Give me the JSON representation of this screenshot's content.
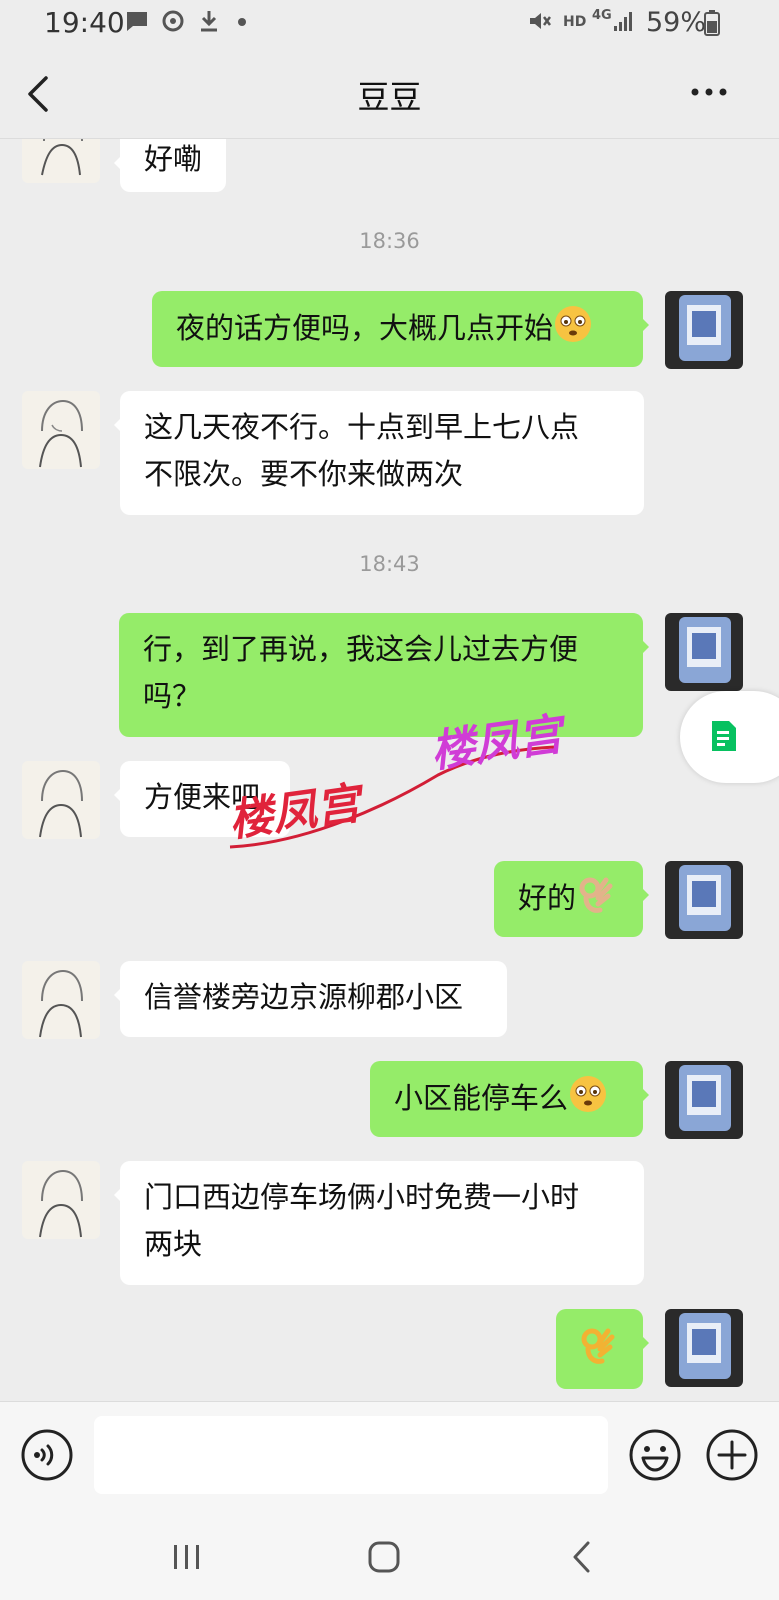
{
  "status_bar": {
    "time": "19:40",
    "network": "4G",
    "hd": "HD",
    "battery": "59%"
  },
  "header": {
    "title": "豆豆"
  },
  "messages": [
    {
      "dir": "in",
      "text": "好嘞"
    },
    {
      "timestamp": "18:36"
    },
    {
      "dir": "out",
      "text": "夜的话方便吗，大概几点开始",
      "emoji": "flushed-face"
    },
    {
      "dir": "in",
      "lines": [
        "这几天夜不行。十点到早上七八点",
        "不限次。要不你来做两次"
      ]
    },
    {
      "timestamp": "18:43"
    },
    {
      "dir": "out",
      "lines": [
        "行，到了再说，我这会儿过去方便",
        "吗？"
      ]
    },
    {
      "dir": "in",
      "text": "方便来吧"
    },
    {
      "dir": "out",
      "text": "好的",
      "emoji": "ok-hand"
    },
    {
      "dir": "in",
      "text": "信誉楼旁边京源柳郡小区"
    },
    {
      "dir": "out",
      "text": "小区能停车么",
      "emoji": "flushed-face"
    },
    {
      "dir": "in",
      "lines": [
        "门口西边停车场俩小时免费一小时",
        "两块"
      ]
    },
    {
      "dir": "out",
      "emoji": "ok-hand"
    }
  ],
  "watermark": {
    "text1": "楼凤宫",
    "text2": "楼凤宫"
  },
  "colors": {
    "outgoing": "#95ec69",
    "incoming": "#ffffff",
    "background": "#ededed"
  }
}
